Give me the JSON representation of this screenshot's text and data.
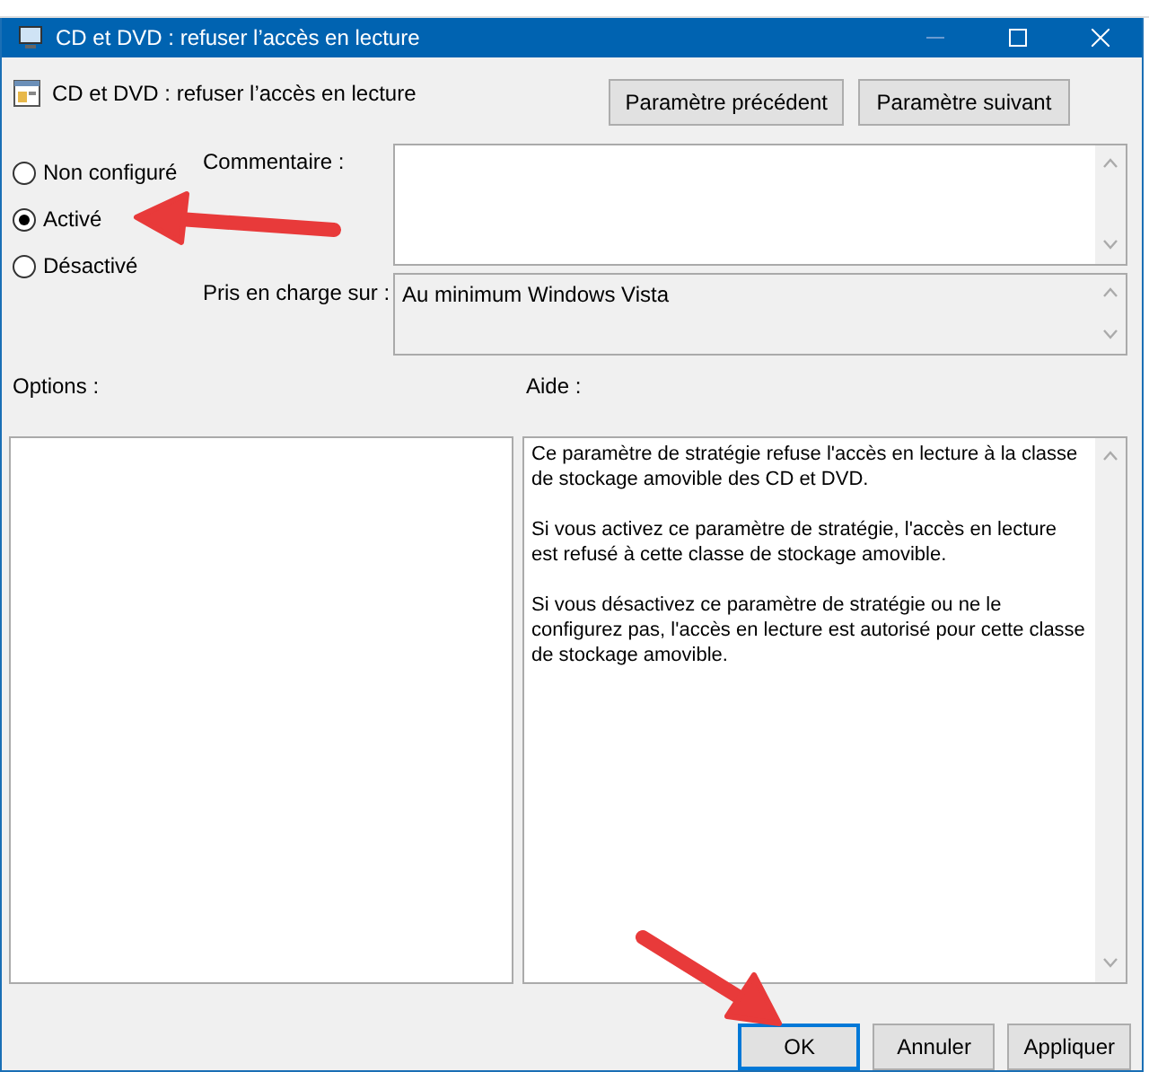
{
  "window": {
    "title": "CD et DVD : refuser l’accès en lecture"
  },
  "header": {
    "title": "CD et DVD : refuser l’accès en lecture",
    "buttons": [
      "Paramètre précédent",
      "Paramètre suivant"
    ]
  },
  "state_options": [
    {
      "label": "Non configuré",
      "selected": false
    },
    {
      "label": "Activé",
      "selected": true
    },
    {
      "label": "Désactivé",
      "selected": false
    }
  ],
  "comment": {
    "label": "Commentaire :"
  },
  "supported_on": {
    "label": "Pris en charge sur :",
    "value": "Au minimum Windows Vista"
  },
  "options": {
    "label": "Options :"
  },
  "help": {
    "label": "Aide :",
    "paragraphs": [
      "Ce paramètre de stratégie refuse l'accès en lecture à la classe de stockage amovible des CD et DVD.",
      "Si vous activez ce paramètre de stratégie, l'accès en lecture est refusé à cette classe de stockage amovible.",
      "Si vous désactivez ce paramètre de stratégie ou ne le configurez pas, l'accès en lecture est autorisé pour cette classe de stockage amovible."
    ]
  },
  "buttons": [
    {
      "label": "OK",
      "default": true
    },
    {
      "label": "Annuler",
      "default": false
    },
    {
      "label": "Appliquer",
      "default": false
    }
  ]
}
